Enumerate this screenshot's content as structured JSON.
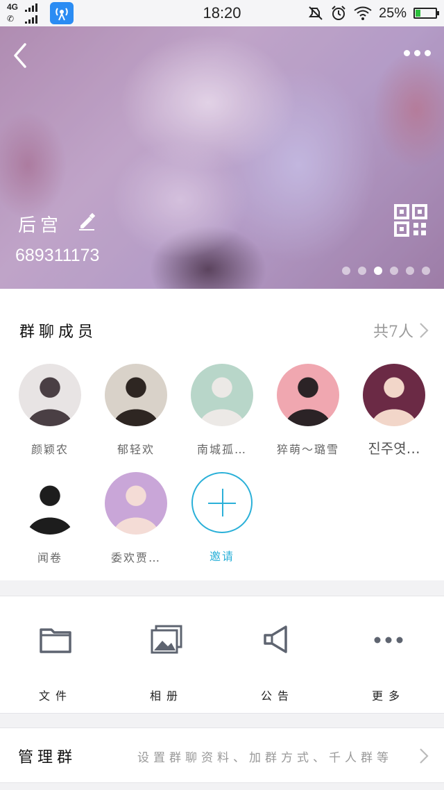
{
  "status_bar": {
    "network": "4G",
    "time": "18:20",
    "battery": "25%",
    "battery_level": 0.25,
    "icons": [
      "signal-icon",
      "call-signal-icon",
      "hotspot-app-icon",
      "mute-icon",
      "alarm-icon",
      "wifi-icon",
      "battery-icon"
    ]
  },
  "header": {
    "group_name": "后宫",
    "group_id": "689311173",
    "carousel_pages": 6,
    "carousel_active_index": 2
  },
  "members": {
    "title": "群聊成员",
    "count_label": "共7人",
    "list": [
      {
        "name": "颜颖农",
        "avatar_colors": [
          "#e8e4e4",
          "#4a3f44"
        ]
      },
      {
        "name": "郁轻欢",
        "avatar_colors": [
          "#d9d2c9",
          "#2e2622"
        ]
      },
      {
        "name": "南城孤…",
        "avatar_colors": [
          "#b8d6c9",
          "#ece9e6"
        ]
      },
      {
        "name": "猝萌～璐雪",
        "avatar_colors": [
          "#f0a7b0",
          "#2b2326"
        ]
      },
      {
        "name": "진주엿…",
        "avatar_colors": [
          "#6b2a45",
          "#f2d6c9"
        ]
      },
      {
        "name": "闻卷",
        "avatar_colors": [
          "#ffffff",
          "#1d1d1d"
        ]
      },
      {
        "name": "委欢贾…",
        "avatar_colors": [
          "#c9a6d8",
          "#f4dcd6"
        ]
      }
    ],
    "invite_label": "邀请",
    "accent": "#2ab0d8"
  },
  "tools": [
    {
      "label": "文件",
      "icon": "folder-icon"
    },
    {
      "label": "相册",
      "icon": "album-icon"
    },
    {
      "label": "公告",
      "icon": "announcement-icon"
    },
    {
      "label": "更多",
      "icon": "more-icon"
    }
  ],
  "manage": {
    "title": "管理群",
    "description": "设置群聊资料、加群方式、千人群等"
  }
}
